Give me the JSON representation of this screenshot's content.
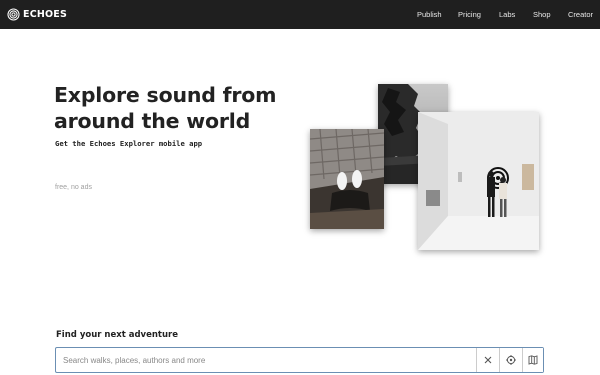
{
  "header": {
    "logo_text": "ECHOES",
    "nav": [
      "Publish",
      "Pricing",
      "Labs",
      "Shop",
      "Creator"
    ]
  },
  "hero": {
    "title_line1": "Explore sound from",
    "title_line2": "around the world",
    "subtitle": "Get the Echoes Explorer mobile app",
    "note": "free, no ads"
  },
  "search": {
    "heading": "Find your next adventure",
    "placeholder": "Search walks, places, authors and more",
    "value": "",
    "buttons": [
      "clear-icon",
      "locate-icon",
      "map-icon"
    ]
  },
  "colors": {
    "topbar": "#1f1f1f",
    "search_border": "#6b8fb3"
  }
}
